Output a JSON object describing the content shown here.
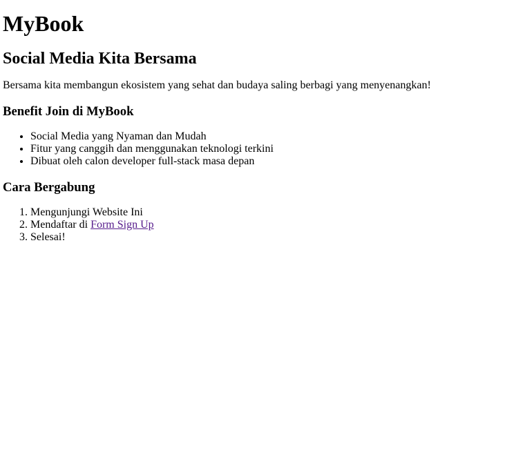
{
  "site_title": "MyBook",
  "tagline": "Social Media Kita Bersama",
  "intro": "Bersama kita membangun ekosistem yang sehat dan budaya saling berbagi yang menyenangkan!",
  "benefits": {
    "heading": "Benefit Join di MyBook",
    "items": [
      "Social Media yang Nyaman dan Mudah",
      "Fitur yang canggih dan menggunakan teknologi terkini",
      "Dibuat oleh calon developer full-stack masa depan"
    ]
  },
  "join": {
    "heading": "Cara Bergabung",
    "step1": "Mengunjungi Website Ini",
    "step2_prefix": "Mendaftar di ",
    "step2_link": "Form Sign Up",
    "step3": "Selesai!"
  },
  "colors": {
    "visited_link": "#551a8b",
    "text": "#000000",
    "background": "#ffffff"
  }
}
